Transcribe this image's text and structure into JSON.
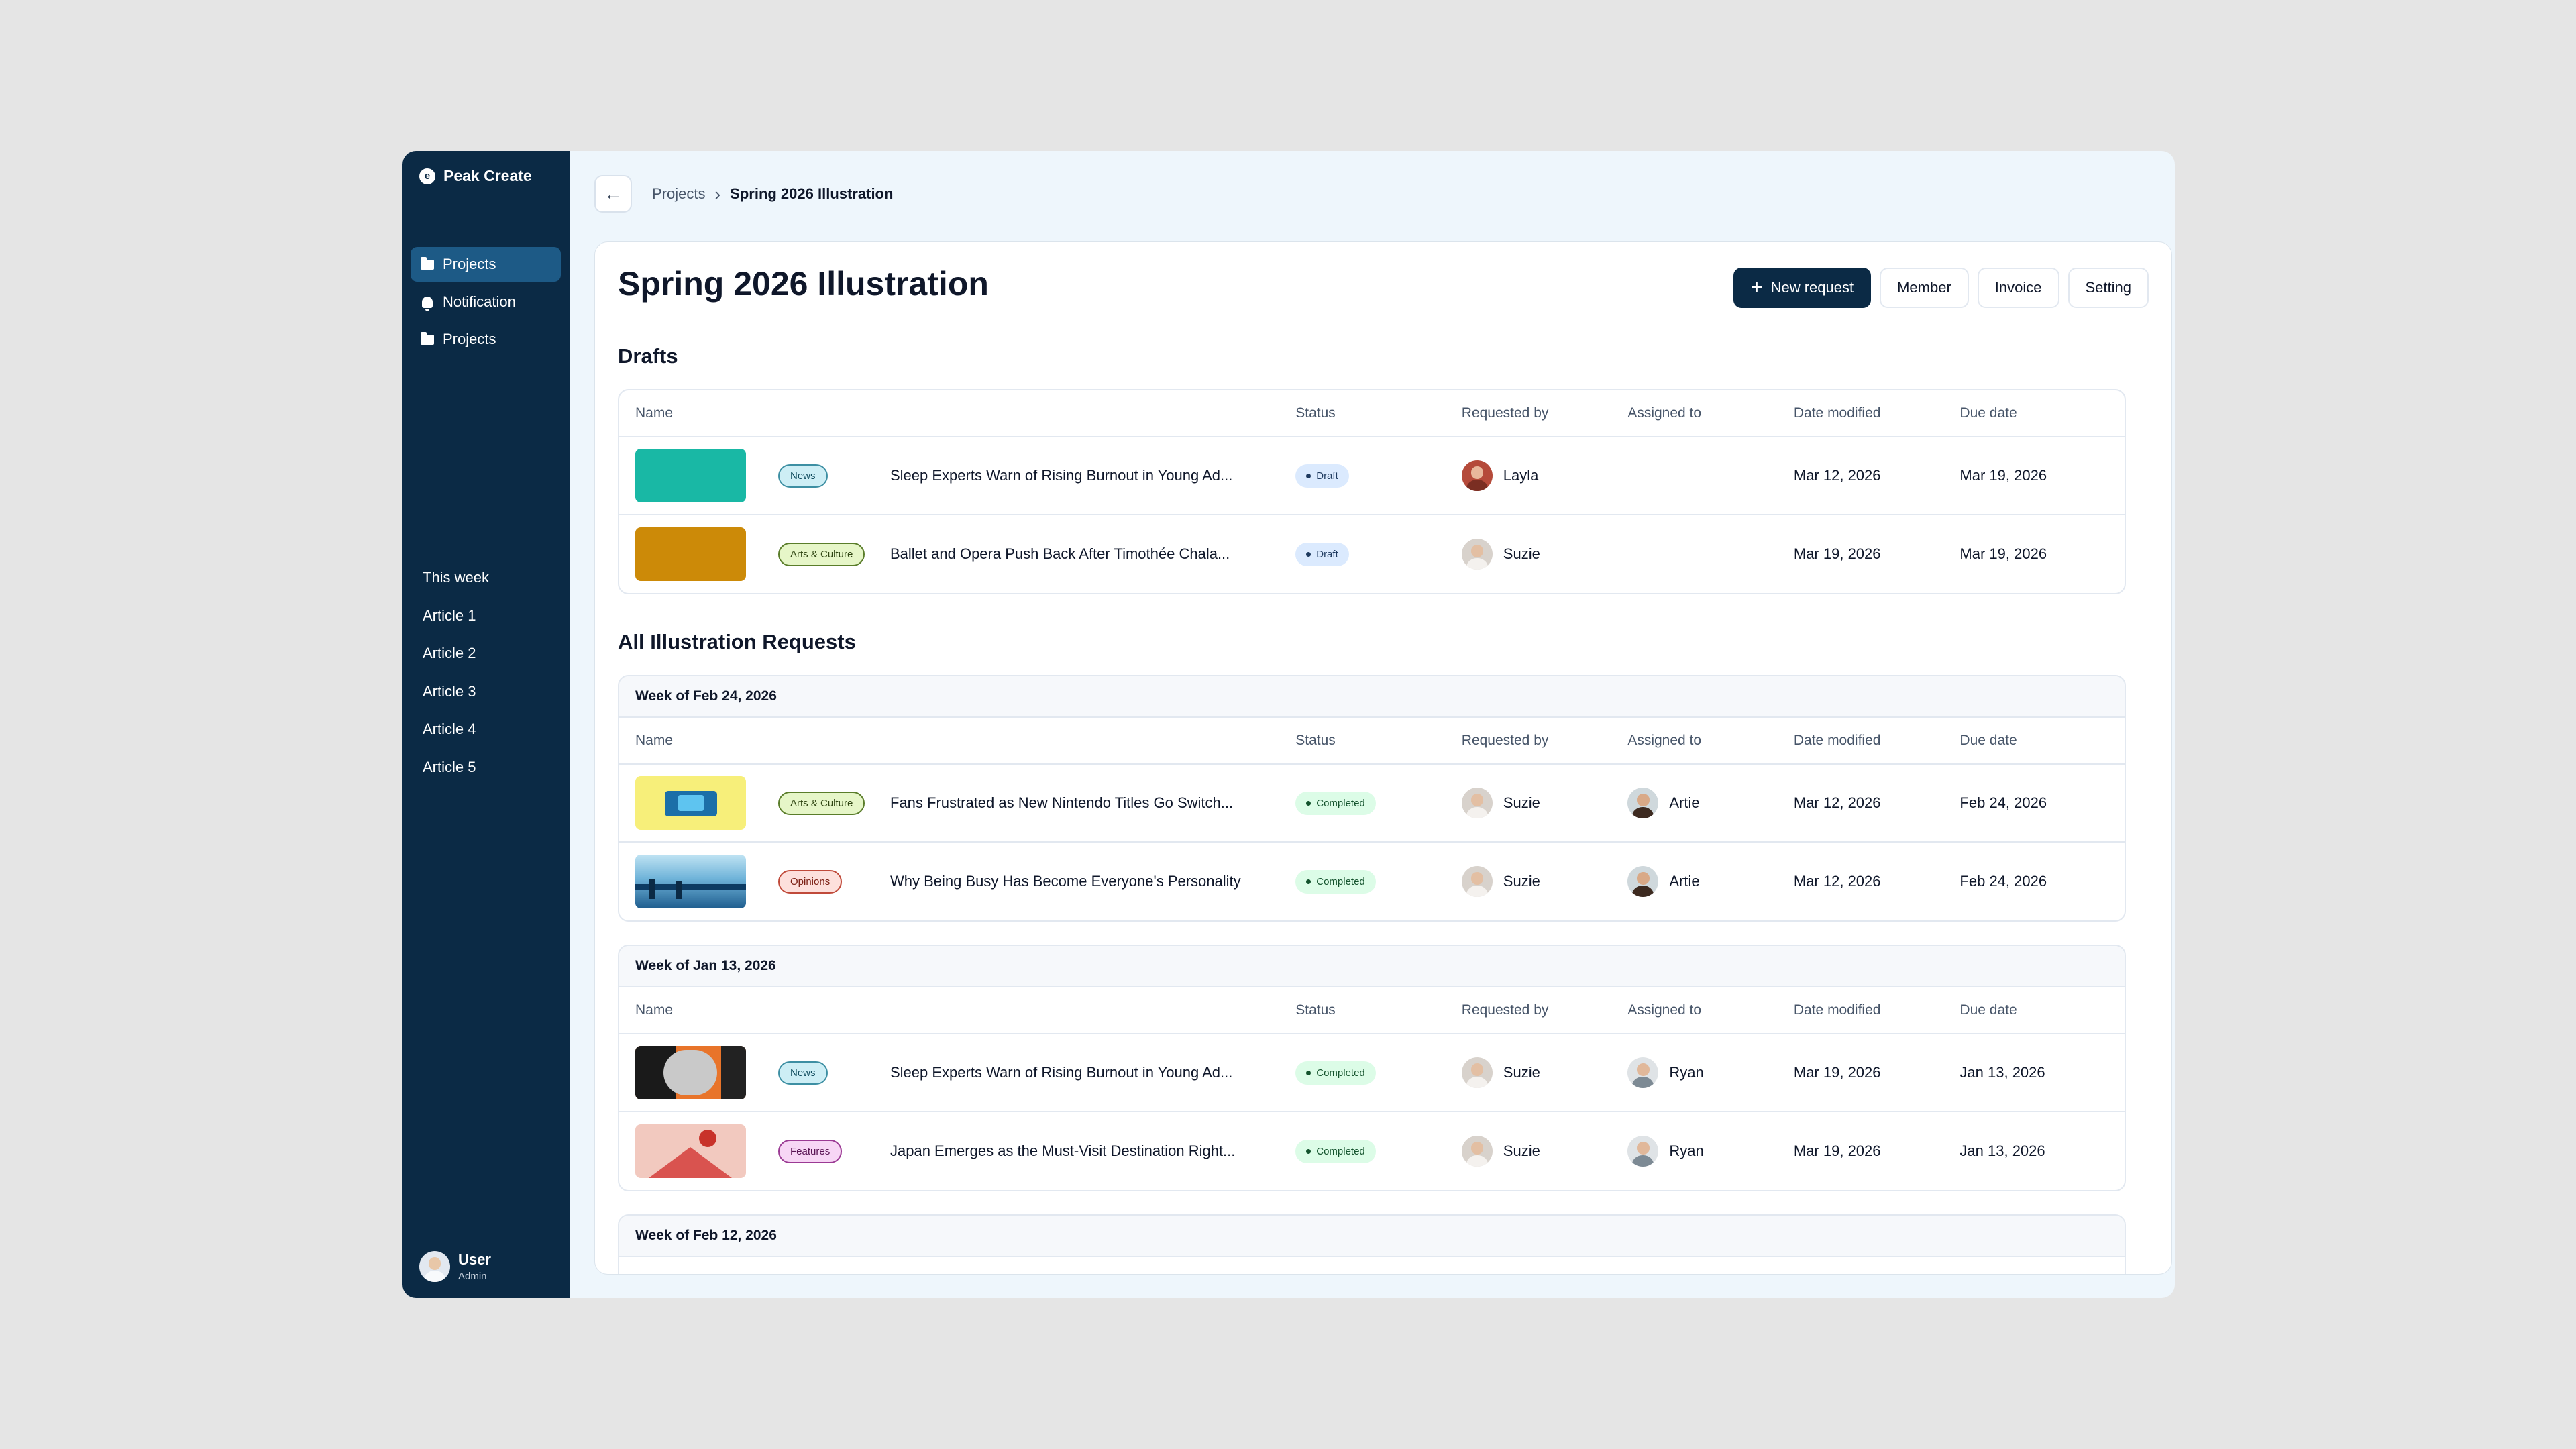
{
  "app": {
    "name": "Peak Create",
    "logo_letter": "e"
  },
  "sidebar": {
    "nav": [
      {
        "label": "Projects",
        "icon": "folder-icon",
        "active": true
      },
      {
        "label": "Notification",
        "icon": "bell-icon",
        "active": false
      },
      {
        "label": "Projects",
        "icon": "folder-icon",
        "active": false
      }
    ],
    "articles": [
      "This week",
      "Article 1",
      "Article 2",
      "Article 3",
      "Article 4",
      "Article 5"
    ],
    "user": {
      "name": "User",
      "role": "Admin"
    }
  },
  "breadcrumb": {
    "parent": "Projects",
    "current": "Spring 2026 Illustration"
  },
  "page": {
    "title": "Spring 2026 Illustration",
    "actions": {
      "new_request": "New request",
      "member": "Member",
      "invoice": "Invoice",
      "setting": "Setting"
    }
  },
  "columns": {
    "name": "Name",
    "status": "Status",
    "requested_by": "Requested by",
    "assigned_to": "Assigned to",
    "date_modified": "Date modified",
    "due_date": "Due date"
  },
  "drafts": {
    "title": "Drafts",
    "rows": [
      {
        "tag": "News",
        "title": "Sleep Experts Warn of Rising Burnout in Young Ad...",
        "status": "Draft",
        "requested_by": "Layla",
        "assigned_to": "",
        "date_modified": "Mar 12, 2026",
        "due_date": "Mar 19, 2026"
      },
      {
        "tag": "Arts & Culture",
        "title": "Ballet and Opera Push Back After Timothée Chala...",
        "status": "Draft",
        "requested_by": "Suzie",
        "assigned_to": "",
        "date_modified": "Mar 19, 2026",
        "due_date": "Mar 19, 2026"
      }
    ]
  },
  "all_requests": {
    "title": "All Illustration Requests",
    "weeks": [
      {
        "label": "Week of Feb 24, 2026",
        "rows": [
          {
            "tag": "Arts & Culture",
            "title": "Fans Frustrated as New Nintendo Titles Go Switch...",
            "status": "Completed",
            "requested_by": "Suzie",
            "assigned_to": "Artie",
            "date_modified": "Mar 12, 2026",
            "due_date": "Feb 24, 2026"
          },
          {
            "tag": "Opinions",
            "title": "Why Being Busy Has Become Everyone's Personality",
            "status": "Completed",
            "requested_by": "Suzie",
            "assigned_to": "Artie",
            "date_modified": "Mar 12, 2026",
            "due_date": "Feb 24, 2026"
          }
        ]
      },
      {
        "label": "Week of Jan 13, 2026",
        "rows": [
          {
            "tag": "News",
            "title": "Sleep Experts Warn of Rising Burnout in Young Ad...",
            "status": "Completed",
            "requested_by": "Suzie",
            "assigned_to": "Ryan",
            "date_modified": "Mar 19, 2026",
            "due_date": "Jan 13, 2026"
          },
          {
            "tag": "Features",
            "title": "Japan Emerges as the Must-Visit Destination Right...",
            "status": "Completed",
            "requested_by": "Suzie",
            "assigned_to": "Ryan",
            "date_modified": "Mar 19, 2026",
            "due_date": "Jan 13, 2026"
          }
        ]
      },
      {
        "label": "Week of Feb 12, 2026",
        "rows": []
      }
    ]
  },
  "colors": {
    "sidebar_bg": "#0b2a45",
    "active_nav": "#1d5a86",
    "tag_news": "#cdeef5",
    "tag_arts": "#e6f6c8",
    "tag_opinions": "#fde0dc",
    "tag_features": "#f7d6f5",
    "draft_pill": "#dbeafe",
    "completed_pill": "#dcfce7"
  }
}
